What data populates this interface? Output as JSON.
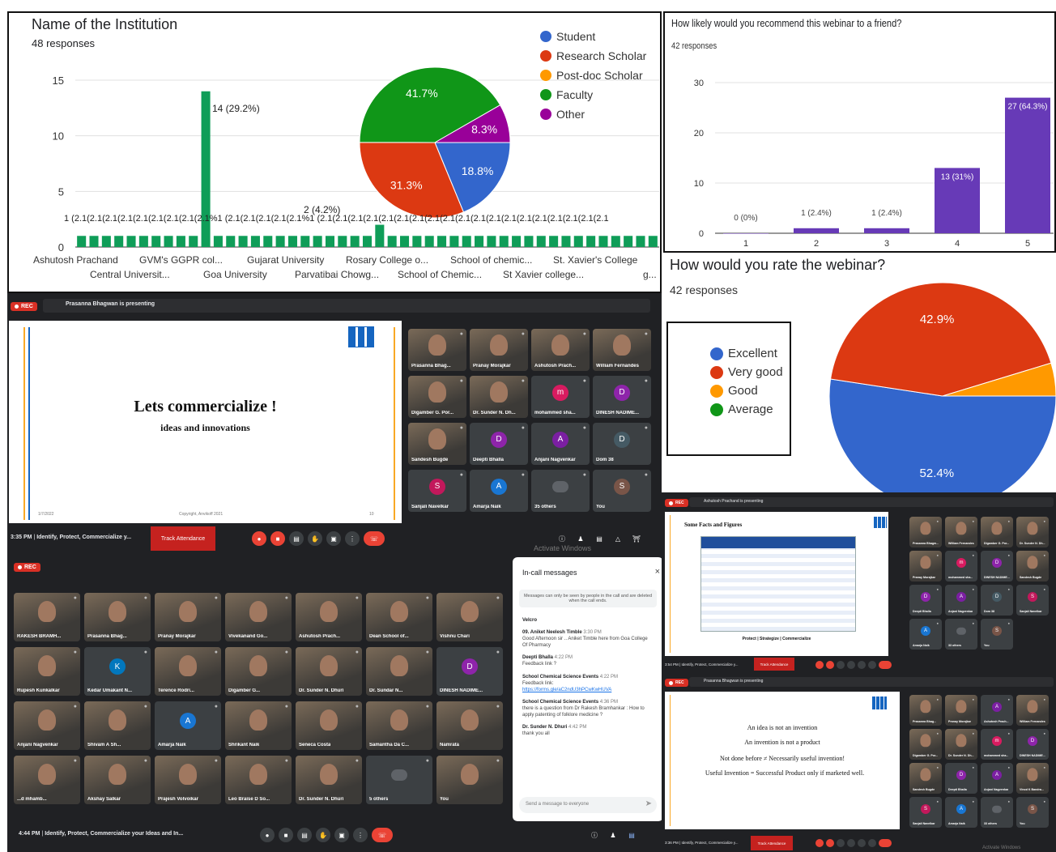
{
  "institution_chart": {
    "title": "Name of the Institution",
    "responses": "48 responses",
    "bar_label_peak": "14 (29.2%)",
    "bar_label_second": "2 (4.2%)",
    "bar_label_row": "1 (2.1(2.1(2.1(2.1(2.1(2.1(2.1(2.1(2.1%1 (2.1(2.1(2.1(2.1(2.1%1 (2.1(2.1(2.1(2.1(2.1(2.1(2.1(2.1(2.1(2.1(2.1(2.1(2.1(2.1(2.1(2.1(2.1(2.1(2.1",
    "cat_row1": [
      "Ashutosh Prachand",
      "GVM's GGPR col...",
      "Gujarat University",
      "Rosary College o...",
      "School of chemic...",
      "St. Xavier's College"
    ],
    "cat_row2": [
      "Central Universit...",
      "Goa University",
      "Parvatibai Chowg...",
      "School of Chemic...",
      "St Xavier college...",
      "g..."
    ]
  },
  "recommend_chart": {
    "title": "How likely would you recommend this webinar to a friend?",
    "responses": "42 responses"
  },
  "rate_chart": {
    "title": "How would you rate the webinar?",
    "responses": "42 responses"
  },
  "chart_data": [
    {
      "type": "bar",
      "title": "Name of the Institution",
      "ylim": [
        0,
        15
      ],
      "yticks": [
        0,
        5,
        10,
        15
      ],
      "bars_shown": 47,
      "values": [
        1,
        1,
        1,
        1,
        1,
        1,
        1,
        1,
        1,
        1,
        14,
        1,
        1,
        1,
        1,
        1,
        1,
        1,
        1,
        1,
        1,
        1,
        1,
        1,
        2,
        1,
        1,
        1,
        1,
        1,
        1,
        1,
        1,
        1,
        1,
        1,
        1,
        1,
        1,
        1,
        1,
        1,
        1,
        1,
        1,
        1,
        1
      ],
      "color": "#0f9d58"
    },
    {
      "type": "pie",
      "title": "Name of the Institution",
      "labels": [
        "Student",
        "Research Scholar",
        "Post-doc Scholar",
        "Faculty",
        "Other"
      ],
      "values": [
        18.8,
        31.3,
        0,
        41.7,
        8.3
      ],
      "value_labels": [
        "18.8%",
        "31.3%",
        "",
        "41.7%",
        "8.3%"
      ],
      "colors": [
        "#3366cc",
        "#dc3912",
        "#ff9900",
        "#109618",
        "#990099"
      ],
      "legend_position": "right"
    },
    {
      "type": "bar",
      "title": "How likely would you recommend this webinar to a friend?",
      "categories": [
        "1",
        "2",
        "3",
        "4",
        "5"
      ],
      "values": [
        0,
        1,
        1,
        13,
        27
      ],
      "value_labels": [
        "0 (0%)",
        "1 (2.4%)",
        "1 (2.4%)",
        "13 (31%)",
        "27 (64.3%)"
      ],
      "ylim": [
        0,
        30
      ],
      "yticks": [
        0,
        10,
        20,
        30
      ],
      "color": "#673ab7"
    },
    {
      "type": "pie",
      "title": "How would you rate the webinar?",
      "labels": [
        "Excellent",
        "Very good",
        "Good",
        "Average"
      ],
      "values": [
        52.4,
        42.9,
        4.7,
        0
      ],
      "value_labels": [
        "52.4%",
        "42.9%",
        "",
        ""
      ],
      "colors": [
        "#3366cc",
        "#dc3912",
        "#ff9900",
        "#109618"
      ],
      "legend_position": "left"
    }
  ],
  "meet1": {
    "rec": "REC",
    "presenting": "Prasanna Bhagwan is presenting",
    "slide_title": "Lets commercialize !",
    "slide_subtitle": "ideas and innovations",
    "slide_date": "1/7/2022",
    "slide_copyright": "Copyright, Anvikoff 2021",
    "slide_page": "10",
    "time": "3:35 PM",
    "meeting": "Identify, Protect, Commercialize y...",
    "track": "Track Attendance",
    "watermark": "Activate Windows",
    "tiles": [
      {
        "name": "Prasanna Bhag...",
        "type": "photo"
      },
      {
        "name": "Pranay Morajkar",
        "type": "photo"
      },
      {
        "name": "Ashutosh Prach...",
        "type": "photo"
      },
      {
        "name": "William Fernandes",
        "type": "photo"
      },
      {
        "name": "Digamber G. Por...",
        "type": "photo"
      },
      {
        "name": "Dr. Sunder N. Dh...",
        "type": "photo"
      },
      {
        "name": "mohammed sha...",
        "letter": "m",
        "color": "#d81b60"
      },
      {
        "name": "DINESH NADIME...",
        "letter": "D",
        "color": "#8e24aa"
      },
      {
        "name": "Sandesh Bugde",
        "type": "photo"
      },
      {
        "name": "Deepti Bhalla",
        "letter": "D",
        "color": "#8e24aa"
      },
      {
        "name": "Anjani Nagvenkar",
        "letter": "A",
        "color": "#7b1fa2"
      },
      {
        "name": "Dom 38",
        "letter": "D",
        "color": "#455a64"
      },
      {
        "name": "Sanjali Navelkar",
        "letter": "S",
        "color": "#c2185b"
      },
      {
        "name": "Amarja Naik",
        "letter": "A",
        "color": "#1976d2"
      },
      {
        "name": "35 others",
        "type": "others"
      },
      {
        "name": "You",
        "letter": "S",
        "color": "#795548"
      }
    ]
  },
  "meet2": {
    "rec": "REC",
    "time": "4:44 PM",
    "meeting": "Identify, Protect, Commercialize your Ideas and In...",
    "tiles": [
      {
        "name": "RAKESH BRAMH...",
        "type": "photo"
      },
      {
        "name": "Prasanna Bhag...",
        "type": "photo"
      },
      {
        "name": "Pranay Morajkar",
        "type": "photo"
      },
      {
        "name": "Vivekanand Go...",
        "type": "photo"
      },
      {
        "name": "Ashutosh Prach...",
        "type": "photo"
      },
      {
        "name": "Dean School of...",
        "type": "photo"
      },
      {
        "name": "Vishnu Chari",
        "type": "photo"
      },
      {
        "name": "Rupesh Kunkalkar",
        "type": "photo"
      },
      {
        "name": "Kedar Umakant N...",
        "letter": "K",
        "color": "#0277bd"
      },
      {
        "name": "Terence Rodri...",
        "type": "photo"
      },
      {
        "name": "Digamber G...",
        "type": "photo"
      },
      {
        "name": "Dr. Sunder N. Dhuri",
        "type": "photo"
      },
      {
        "name": "Dr. Sundar N...",
        "type": "photo"
      },
      {
        "name": "DINESH NADIME...",
        "letter": "D",
        "color": "#8e24aa"
      },
      {
        "name": "Anjani Nagvenkar",
        "type": "photo"
      },
      {
        "name": "Shivam A Sh...",
        "type": "photo"
      },
      {
        "name": "Amarja Naik",
        "letter": "A",
        "color": "#1976d2"
      },
      {
        "name": "Shrikant Naik",
        "type": "photo"
      },
      {
        "name": "Seneca Costa",
        "type": "photo"
      },
      {
        "name": "Samantha Da C...",
        "type": "photo"
      },
      {
        "name": "Namrata",
        "type": "photo"
      },
      {
        "name": "...d mhamb...",
        "type": "photo"
      },
      {
        "name": "Akshay Salkar",
        "type": "photo"
      },
      {
        "name": "Prajesh Volvoikar",
        "type": "photo"
      },
      {
        "name": "Leo Braise D So...",
        "type": "photo"
      },
      {
        "name": "Dr. Sunder N. Dhuri",
        "type": "photo"
      },
      {
        "name": "5 others",
        "type": "others"
      },
      {
        "name": "You",
        "type": "photo"
      }
    ],
    "chat": {
      "title": "In-call messages",
      "notice": "Messages can only be seen by people in the call and are deleted when the call ends.",
      "messages": [
        {
          "sender": "Velcro",
          "time": "",
          "text": ""
        },
        {
          "sender": "09. Aniket Neelesh Timble",
          "time": "3:30 PM",
          "text": "Good Afternoon sir .. Aniket Timble here from Goa College Of Pharmacy"
        },
        {
          "sender": "Deepti Bhalla",
          "time": "4:22 PM",
          "text": "Feedback link ?"
        },
        {
          "sender": "School Chemical Science Events",
          "time": "4:22 PM",
          "text": "Feedback link:",
          "link": "https://forms.gle/aC2ndU3hPCwKwHUVA"
        },
        {
          "sender": "School Chemical Science Events",
          "time": "4:36 PM",
          "text": "there is a question from Dr Rakesh Bramhankar : How to apply patenting of folklore medicine ?"
        },
        {
          "sender": "Dr. Sunder N. Dhuri",
          "time": "4:42 PM",
          "text": "thank you all"
        }
      ],
      "input_placeholder": "Send a message to everyone"
    }
  },
  "meet3": {
    "rec": "REC",
    "presenting": "Ashutosh Prachand is presenting",
    "slide_title": "Some Facts and Figures",
    "slide_footer": "Protect | Strategize | Commercialize",
    "time": "3:54 PM",
    "meeting": "Identify, Protect, Commercialize y...",
    "track": "Track Attendance",
    "tiles": [
      "Prasanna Bhagw...",
      "William Fernandes",
      "Digamber G. Por...",
      "Dr. Sunder N. Dh...",
      "Pranay Morajkar",
      "mohammed sha...",
      "DINESH NADIME...",
      "Sandesh Bugde",
      "Deepti Bhalla",
      "Anjani Nagvenkar",
      "Dom 38",
      "Sanjali Navelkar",
      "Amarja Naik",
      "33 others",
      "You"
    ]
  },
  "meet4": {
    "rec": "REC",
    "presenting": "Prasanna Bhagwan is presenting",
    "slide_lines": [
      "An idea is not an invention",
      "An invention is not a product",
      "Not done before  ≠ Necessarily useful invention!",
      "Useful Invention  = Successful Product only if marketed well."
    ],
    "time": "3:36 PM",
    "meeting": "Identify, Protect, Commercialize y...",
    "track": "Track Attendance",
    "watermark": "Activate Windows",
    "tiles": [
      "Prasanna Bhag...",
      "Pranay Morajkar",
      "Ashutosh Prach...",
      "William Fernandes",
      "Digamber G. Por...",
      "Dr. Sunder N. Dh...",
      "mohammed sha...",
      "DINESH NADIME...",
      "Sandesh Bugde",
      "Deepti Bhalla",
      "Anjani Nagvenkar",
      "Vinod K Bandra...",
      "Sanjali Navelkar",
      "Amarja Naik",
      "33 others",
      "You"
    ]
  }
}
